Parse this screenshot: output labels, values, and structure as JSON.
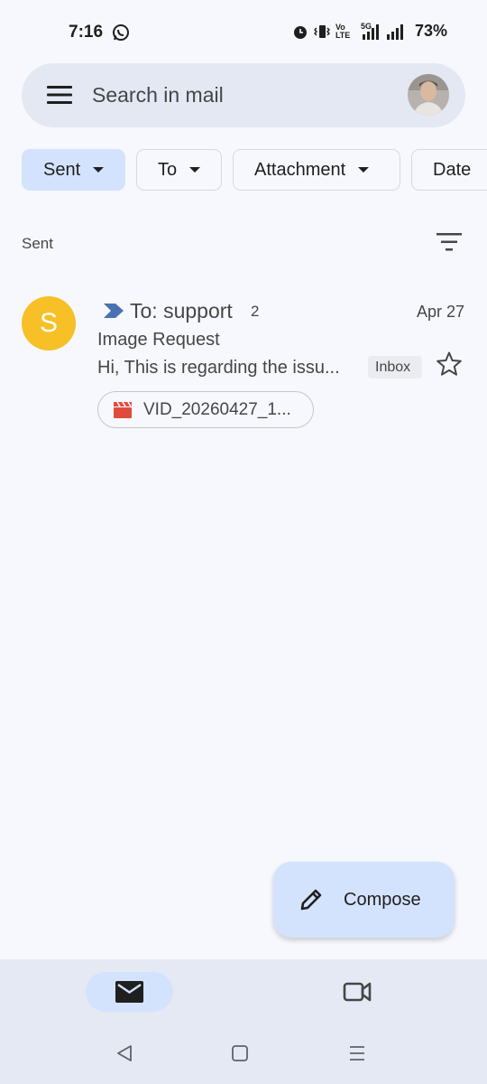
{
  "status_bar": {
    "time": "7:16",
    "network_label": "5G",
    "volte_label": "Vo LTE",
    "battery": "73%"
  },
  "search": {
    "placeholder": "Search in mail"
  },
  "filters": [
    {
      "label": "Sent",
      "active": true
    },
    {
      "label": "To",
      "active": false
    },
    {
      "label": "Attachment",
      "active": false
    },
    {
      "label": "Date",
      "active": false
    }
  ],
  "section": {
    "label": "Sent"
  },
  "emails": [
    {
      "avatar_letter": "S",
      "avatar_color": "#f6c026",
      "recipient": "To: support",
      "thread_count": "2",
      "date": "Apr 27",
      "subject": "Image Request",
      "snippet": "Hi, This is regarding the issu...",
      "label": "Inbox",
      "attachment": "VID_20260427_1..."
    }
  ],
  "compose": {
    "label": "Compose"
  },
  "icons": {
    "menu": "menu-icon",
    "filter": "filter-icon",
    "star": "star-icon",
    "importance": "importance-marker-icon",
    "attachment": "video-clapper-icon",
    "compose": "pencil-icon",
    "nav_mail": "mail-icon",
    "nav_meet": "video-camera-icon"
  },
  "colors": {
    "accent": "#d3e3fd",
    "avatar": "#f6c026",
    "importance": "#4a72b3",
    "attachment": "#e04c3c"
  }
}
